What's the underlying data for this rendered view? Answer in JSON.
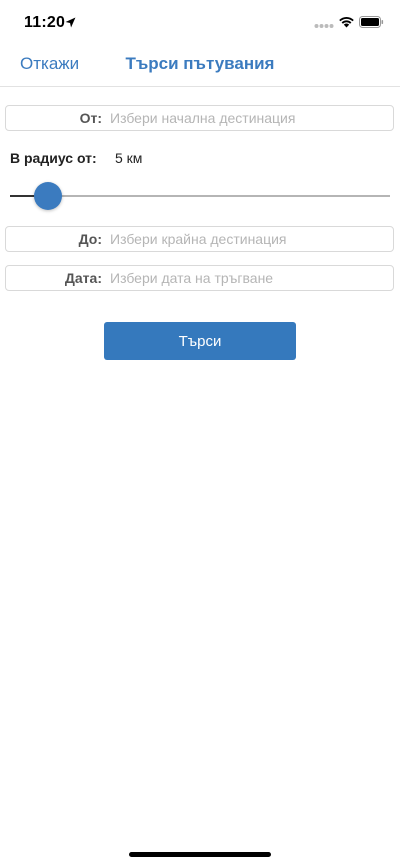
{
  "status_bar": {
    "time": "11:20",
    "icons": [
      "location-arrow-icon",
      "signal-dots-icon",
      "wifi-icon",
      "battery-icon"
    ]
  },
  "nav": {
    "cancel_label": "Откажи",
    "title": "Търси пътувания"
  },
  "form": {
    "from": {
      "label": "От:",
      "placeholder": "Избери начална дестинация"
    },
    "radius": {
      "label": "В радиус от:",
      "value": "5 км",
      "slider_fraction": 0.1
    },
    "to": {
      "label": "До:",
      "placeholder": "Избери крайна дестинация"
    },
    "date": {
      "label": "Дата:",
      "placeholder": "Избери дата на тръгване"
    }
  },
  "search_button": {
    "label": "Търси"
  },
  "colors": {
    "accent": "#3b7bbf",
    "button": "#3579bd",
    "placeholder": "#b5b5b5"
  }
}
